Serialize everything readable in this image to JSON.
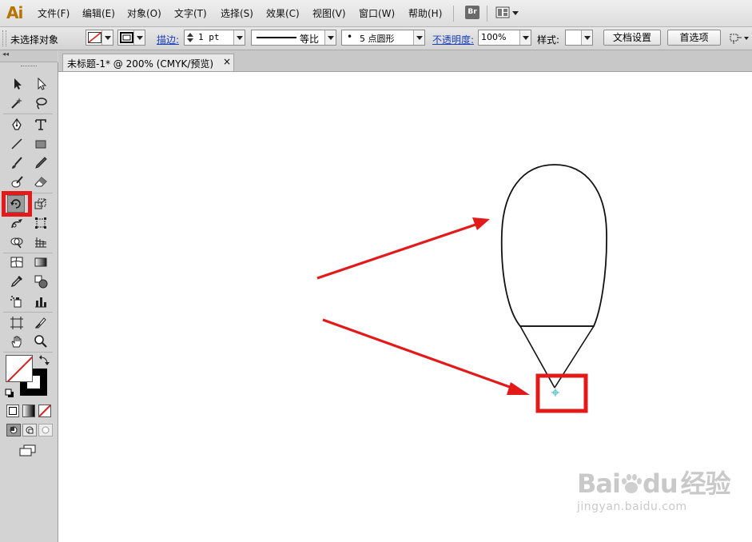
{
  "app": {
    "logo": "Ai",
    "br_label": "Br"
  },
  "menu": [
    "文件(F)",
    "编辑(E)",
    "对象(O)",
    "文字(T)",
    "选择(S)",
    "效果(C)",
    "视图(V)",
    "窗口(W)",
    "帮助(H)"
  ],
  "control_bar": {
    "selection_status": "未选择对象",
    "stroke_label": "描边:",
    "stroke_weight": "1 pt",
    "profile_label": "等比",
    "brush_label": "5 点圆形",
    "brush_dot": "•",
    "opacity_label": "不透明度:",
    "opacity_value": "100%",
    "style_label": "样式:",
    "doc_setup_button": "文档设置",
    "preferences_button": "首选项"
  },
  "toolbox": {
    "collapse_glyph": "◂◂"
  },
  "document": {
    "tab_title": "未标题-1* @ 200% (CMYK/预览)",
    "close_glyph": "×"
  },
  "watermark": {
    "brand_left": "Bai",
    "brand_right": "du",
    "brand_cn": "经验",
    "url": "jingyan.baidu.com"
  },
  "colors": {
    "highlight": "#e21a1a",
    "arrow": "#e21a1a",
    "logo": "#b87400"
  }
}
